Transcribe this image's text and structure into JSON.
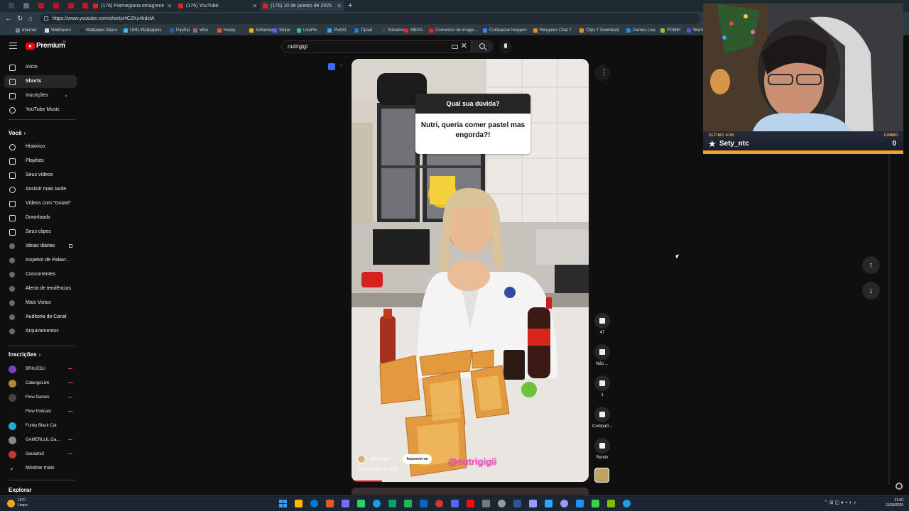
{
  "browser": {
    "tabs": [
      {
        "title": "(176) Parmegiana emagrece",
        "active": false
      },
      {
        "title": "(176) YouTube",
        "active": false
      },
      {
        "title": "(176) 10 de janeiro de 2025",
        "active": true
      }
    ],
    "new_tab": "+",
    "url": "https://www.youtube.com/shorts/4CZKz4kdztA",
    "bookmarks": [
      {
        "label": "Internet",
        "color": "#6f8796"
      },
      {
        "label": "Wallhaven",
        "color": "#d8d8d8"
      },
      {
        "label": "Wallpaper Abyss",
        "color": "#2a2a2a"
      },
      {
        "label": "UHD Wallpapers",
        "color": "#49b3e8"
      },
      {
        "label": "PayPal",
        "color": "#2b5fb4"
      },
      {
        "label": "Woo",
        "color": "#9b5c8f"
      },
      {
        "label": "Husky",
        "color": "#e0582a"
      },
      {
        "label": "AdSense",
        "color": "#f4b400"
      },
      {
        "label": "Stripe",
        "color": "#635bff"
      },
      {
        "label": "LivePix",
        "color": "#35b9a3"
      },
      {
        "label": "PixGG",
        "color": "#38a3f1"
      },
      {
        "label": "Tipsal",
        "color": "#1e7be0"
      },
      {
        "label": "Streamer",
        "color": "#444"
      },
      {
        "label": "MEGA",
        "color": "#d9272e"
      },
      {
        "label": "Conversor de image...",
        "color": "#e22"
      },
      {
        "label": "Compactar Imagem",
        "color": "#2d86ff"
      },
      {
        "label": "Resgates Chat T",
        "color": "#e48b2b"
      },
      {
        "label": "Clips T Download",
        "color": "#e48b2b"
      },
      {
        "label": "Games Live",
        "color": "#1b89ff"
      },
      {
        "label": "PGMEI",
        "color": "#8ec63f"
      },
      {
        "label": "Warn",
        "color": "#6a4bd8"
      }
    ]
  },
  "youtube": {
    "logo_text": "Premium",
    "logo_country": "BR",
    "search": {
      "value": "nutrigigi"
    },
    "sidebar": {
      "main": [
        {
          "label": "Início",
          "icon": "home-icon",
          "active": false
        },
        {
          "label": "Shorts",
          "icon": "shorts-icon",
          "active": true
        },
        {
          "label": "Inscrições",
          "icon": "subscriptions-icon",
          "active": false
        },
        {
          "label": "YouTube Music",
          "icon": "music-icon",
          "active": false
        }
      ],
      "you_heading": "Você",
      "you": [
        {
          "label": "Histórico",
          "icon": "history-icon"
        },
        {
          "label": "Playlists",
          "icon": "playlist-icon"
        },
        {
          "label": "Seus vídeos",
          "icon": "your-videos-icon"
        },
        {
          "label": "Assistir mais tarde",
          "icon": "watch-later-icon"
        },
        {
          "label": "Vídeos com \"Gostei\"",
          "icon": "liked-icon"
        },
        {
          "label": "Downloads",
          "icon": "download-icon"
        },
        {
          "label": "Seus clipes",
          "icon": "clips-icon"
        },
        {
          "label": "Ideias diárias",
          "icon": "ext-icon"
        },
        {
          "label": "Inspetor de Palavr...",
          "icon": "ext-icon"
        },
        {
          "label": "Concorrentes",
          "icon": "ext-icon"
        },
        {
          "label": "Alerta de tendências",
          "icon": "ext-icon"
        },
        {
          "label": "Mais Vistos",
          "icon": "ext-icon"
        },
        {
          "label": "Auditoria do Canal",
          "icon": "ext-icon"
        },
        {
          "label": "Arquivamentos",
          "icon": "ext-icon"
        }
      ],
      "subs_heading": "Inscrições",
      "subscriptions": [
        {
          "label": "BRKsEDU",
          "color": "#7d3cc4",
          "live": true
        },
        {
          "label": "CalangoLive",
          "color": "#b48a2c",
          "live": true
        },
        {
          "label": "Flow Games",
          "color": "#444",
          "live": true
        },
        {
          "label": "Flow Podcast",
          "color": "#111",
          "live": true
        },
        {
          "label": "Funky Black Cat",
          "color": "#2aa7c9",
          "live": false
        },
        {
          "label": "GAMERLLIL Ga...",
          "color": "#888",
          "live": true
        },
        {
          "label": "Goularte2",
          "color": "#c0392b",
          "live": true
        }
      ],
      "show_more": "Mostrar mais",
      "explore_heading": "Explorar"
    },
    "short": {
      "question_header": "Qual sua dúvida?",
      "question_body": "Nutri, queria comer pastel mas engorda?!",
      "channel_name": "@NutriGigii",
      "subscribe_label": "Inscrever-se",
      "date": "10 de janeiro de 2025",
      "tag": "@nutrigigii",
      "progress": 0.13
    },
    "actions": {
      "likes": "47",
      "dislike": "Não ...",
      "comments": "1",
      "share": "Compart...",
      "remix": "Remix"
    }
  },
  "overlay": {
    "last_sub_label": "ÚLTIMO SUB",
    "last_sub_user": "Sety_ntc",
    "combo_label": "COMBO",
    "combo_value": "0"
  },
  "taskbar": {
    "weather_temp": "13°C",
    "weather_desc": "Limpo",
    "time": "21:00",
    "date": "11/09/2025",
    "app_colors": [
      "#ffb900",
      "#0078d4",
      "#e25822",
      "#7b68ee",
      "#25d366",
      "#1b9de2",
      "#00a36c",
      "#1db954",
      "#0a66c2",
      "#d13438",
      "#5865f2",
      "#f40f02",
      "#777",
      "#999",
      "#2b5797",
      "#9999ff",
      "#31a8ff",
      "#9999ff",
      "#1e90ff",
      "#3ccf4e",
      "#7fba00",
      "#1b9de2"
    ]
  }
}
